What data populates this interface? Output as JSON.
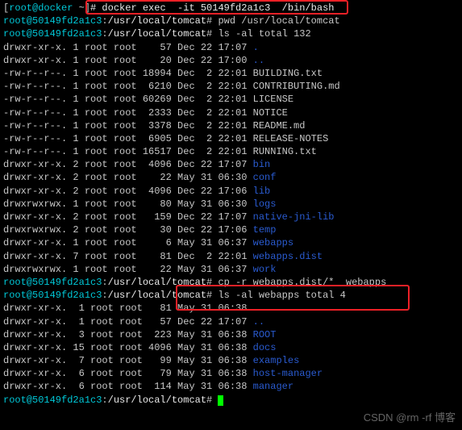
{
  "host_prompt": {
    "user": "root",
    "host": "docker",
    "path": "~",
    "cmd": "docker exec  -it 50149fd2a1c3  /bin/bash"
  },
  "container_prompt": {
    "user": "root",
    "host": "50149fd2a1c3",
    "path": "/usr/local/tomcat"
  },
  "cmd_pwd": "pwd",
  "pwd_out": "/usr/local/tomcat",
  "cmd_ls": "ls -al",
  "total1": "total 132",
  "ls1": [
    {
      "perm": "drwxr-xr-x.",
      "n": "1",
      "o": "root",
      "g": "root",
      "sz": "   57",
      "date": "Dec 22 17:07",
      "name": ".",
      "dir": true
    },
    {
      "perm": "drwxr-xr-x.",
      "n": "1",
      "o": "root",
      "g": "root",
      "sz": "   20",
      "date": "Dec 22 17:00",
      "name": "..",
      "dir": true
    },
    {
      "perm": "-rw-r--r--.",
      "n": "1",
      "o": "root",
      "g": "root",
      "sz": "18994",
      "date": "Dec  2 22:01",
      "name": "BUILDING.txt",
      "dir": false
    },
    {
      "perm": "-rw-r--r--.",
      "n": "1",
      "o": "root",
      "g": "root",
      "sz": " 6210",
      "date": "Dec  2 22:01",
      "name": "CONTRIBUTING.md",
      "dir": false
    },
    {
      "perm": "-rw-r--r--.",
      "n": "1",
      "o": "root",
      "g": "root",
      "sz": "60269",
      "date": "Dec  2 22:01",
      "name": "LICENSE",
      "dir": false
    },
    {
      "perm": "-rw-r--r--.",
      "n": "1",
      "o": "root",
      "g": "root",
      "sz": " 2333",
      "date": "Dec  2 22:01",
      "name": "NOTICE",
      "dir": false
    },
    {
      "perm": "-rw-r--r--.",
      "n": "1",
      "o": "root",
      "g": "root",
      "sz": " 3378",
      "date": "Dec  2 22:01",
      "name": "README.md",
      "dir": false
    },
    {
      "perm": "-rw-r--r--.",
      "n": "1",
      "o": "root",
      "g": "root",
      "sz": " 6905",
      "date": "Dec  2 22:01",
      "name": "RELEASE-NOTES",
      "dir": false
    },
    {
      "perm": "-rw-r--r--.",
      "n": "1",
      "o": "root",
      "g": "root",
      "sz": "16517",
      "date": "Dec  2 22:01",
      "name": "RUNNING.txt",
      "dir": false
    },
    {
      "perm": "drwxr-xr-x.",
      "n": "2",
      "o": "root",
      "g": "root",
      "sz": " 4096",
      "date": "Dec 22 17:07",
      "name": "bin",
      "dir": true
    },
    {
      "perm": "drwxr-xr-x.",
      "n": "2",
      "o": "root",
      "g": "root",
      "sz": "   22",
      "date": "May 31 06:30",
      "name": "conf",
      "dir": true
    },
    {
      "perm": "drwxr-xr-x.",
      "n": "2",
      "o": "root",
      "g": "root",
      "sz": " 4096",
      "date": "Dec 22 17:06",
      "name": "lib",
      "dir": true
    },
    {
      "perm": "drwxrwxrwx.",
      "n": "1",
      "o": "root",
      "g": "root",
      "sz": "   80",
      "date": "May 31 06:30",
      "name": "logs",
      "dir": true
    },
    {
      "perm": "drwxr-xr-x.",
      "n": "2",
      "o": "root",
      "g": "root",
      "sz": "  159",
      "date": "Dec 22 17:07",
      "name": "native-jni-lib",
      "dir": true
    },
    {
      "perm": "drwxrwxrwx.",
      "n": "2",
      "o": "root",
      "g": "root",
      "sz": "   30",
      "date": "Dec 22 17:06",
      "name": "temp",
      "dir": true
    },
    {
      "perm": "drwxr-xr-x.",
      "n": "1",
      "o": "root",
      "g": "root",
      "sz": "    6",
      "date": "May 31 06:37",
      "name": "webapps",
      "dir": true
    },
    {
      "perm": "drwxr-xr-x.",
      "n": "7",
      "o": "root",
      "g": "root",
      "sz": "   81",
      "date": "Dec  2 22:01",
      "name": "webapps.dist",
      "dir": true
    },
    {
      "perm": "drwxrwxrwx.",
      "n": "1",
      "o": "root",
      "g": "root",
      "sz": "   22",
      "date": "May 31 06:37",
      "name": "work",
      "dir": true
    }
  ],
  "cmd_cp": "cp -r webapps.dist/*  webapps",
  "cmd_ls2": "ls -al webapps",
  "total2": "total 4",
  "ls2": [
    {
      "perm": "drwxr-xr-x.",
      "n": " 1",
      "o": "root",
      "g": "root",
      "sz": "  81",
      "date": "May 31 06:38",
      "name": ".",
      "dir": true
    },
    {
      "perm": "drwxr-xr-x.",
      "n": " 1",
      "o": "root",
      "g": "root",
      "sz": "  57",
      "date": "Dec 22 17:07",
      "name": "..",
      "dir": true
    },
    {
      "perm": "drwxr-xr-x.",
      "n": " 3",
      "o": "root",
      "g": "root",
      "sz": " 223",
      "date": "May 31 06:38",
      "name": "ROOT",
      "dir": true
    },
    {
      "perm": "drwxr-xr-x.",
      "n": "15",
      "o": "root",
      "g": "root",
      "sz": "4096",
      "date": "May 31 06:38",
      "name": "docs",
      "dir": true
    },
    {
      "perm": "drwxr-xr-x.",
      "n": " 7",
      "o": "root",
      "g": "root",
      "sz": "  99",
      "date": "May 31 06:38",
      "name": "examples",
      "dir": true
    },
    {
      "perm": "drwxr-xr-x.",
      "n": " 6",
      "o": "root",
      "g": "root",
      "sz": "  79",
      "date": "May 31 06:38",
      "name": "host-manager",
      "dir": true
    },
    {
      "perm": "drwxr-xr-x.",
      "n": " 6",
      "o": "root",
      "g": "root",
      "sz": " 114",
      "date": "May 31 06:38",
      "name": "manager",
      "dir": true
    }
  ],
  "watermark": "CSDN @rm -rf 博客"
}
